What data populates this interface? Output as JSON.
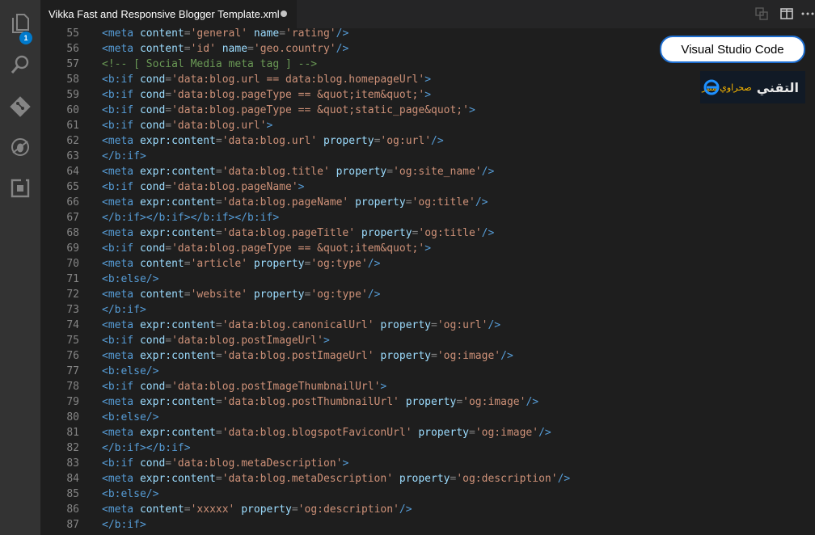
{
  "activity_bar": {
    "items": [
      {
        "name": "explorer-icon",
        "badge": "1"
      },
      {
        "name": "search-icon"
      },
      {
        "name": "source-control-icon"
      },
      {
        "name": "debug-icon"
      },
      {
        "name": "extensions-icon"
      }
    ]
  },
  "tab": {
    "title": "Vikka Fast and Responsive Blogger Template.xml",
    "dirty": true
  },
  "toolbar": {
    "actions": [
      "open-changes-icon",
      "split-editor-icon",
      "more-actions-icon"
    ]
  },
  "overlay": {
    "callout_text": "Visual Studio Code",
    "brand_main": "التقني",
    "brand_sub": "صحراوي منير",
    "brand_icon": "e"
  },
  "colors": {
    "tag": "#569cd6",
    "attr": "#9cdcfe",
    "string": "#ce9178",
    "comment": "#6a9955",
    "text": "#d4d4d4",
    "line_number": "#858585",
    "accent": "#007acc"
  },
  "editor": {
    "lines": [
      {
        "n": "55",
        "tokens": [
          [
            "tag",
            "<meta "
          ],
          [
            "attr",
            "content"
          ],
          [
            "pun",
            "="
          ],
          [
            "str",
            "'general'"
          ],
          [
            "txt",
            " "
          ],
          [
            "attr",
            "name"
          ],
          [
            "pun",
            "="
          ],
          [
            "str",
            "'rating'"
          ],
          [
            "tag",
            "/>"
          ]
        ]
      },
      {
        "n": "56",
        "tokens": [
          [
            "tag",
            "<meta "
          ],
          [
            "attr",
            "content"
          ],
          [
            "pun",
            "="
          ],
          [
            "str",
            "'id'"
          ],
          [
            "txt",
            " "
          ],
          [
            "attr",
            "name"
          ],
          [
            "pun",
            "="
          ],
          [
            "str",
            "'geo.country'"
          ],
          [
            "tag",
            "/>"
          ]
        ]
      },
      {
        "n": "57",
        "tokens": [
          [
            "cmt",
            "<!-- [ Social Media meta tag ] -->"
          ]
        ]
      },
      {
        "n": "58",
        "tokens": [
          [
            "tag",
            "<b:if "
          ],
          [
            "attr",
            "cond"
          ],
          [
            "pun",
            "="
          ],
          [
            "str",
            "'data:blog.url == data:blog.homepageUrl'"
          ],
          [
            "tag",
            ">"
          ]
        ]
      },
      {
        "n": "59",
        "tokens": [
          [
            "tag",
            "<b:if "
          ],
          [
            "attr",
            "cond"
          ],
          [
            "pun",
            "="
          ],
          [
            "str",
            "'data:blog.pageType == &quot;item&quot;'"
          ],
          [
            "tag",
            ">"
          ]
        ]
      },
      {
        "n": "60",
        "tokens": [
          [
            "tag",
            "<b:if "
          ],
          [
            "attr",
            "cond"
          ],
          [
            "pun",
            "="
          ],
          [
            "str",
            "'data:blog.pageType == &quot;static_page&quot;'"
          ],
          [
            "tag",
            ">"
          ]
        ]
      },
      {
        "n": "61",
        "tokens": [
          [
            "tag",
            "<b:if "
          ],
          [
            "attr",
            "cond"
          ],
          [
            "pun",
            "="
          ],
          [
            "str",
            "'data:blog.url'"
          ],
          [
            "tag",
            ">"
          ]
        ]
      },
      {
        "n": "62",
        "tokens": [
          [
            "tag",
            "<meta "
          ],
          [
            "attr",
            "expr:content"
          ],
          [
            "pun",
            "="
          ],
          [
            "str",
            "'data:blog.url'"
          ],
          [
            "txt",
            " "
          ],
          [
            "attr",
            "property"
          ],
          [
            "pun",
            "="
          ],
          [
            "str",
            "'og:url'"
          ],
          [
            "tag",
            "/>"
          ]
        ]
      },
      {
        "n": "63",
        "tokens": [
          [
            "tag",
            "</b:if>"
          ]
        ]
      },
      {
        "n": "64",
        "tokens": [
          [
            "tag",
            "<meta "
          ],
          [
            "attr",
            "expr:content"
          ],
          [
            "pun",
            "="
          ],
          [
            "str",
            "'data:blog.title'"
          ],
          [
            "txt",
            " "
          ],
          [
            "attr",
            "property"
          ],
          [
            "pun",
            "="
          ],
          [
            "str",
            "'og:site_name'"
          ],
          [
            "tag",
            "/>"
          ]
        ]
      },
      {
        "n": "65",
        "tokens": [
          [
            "tag",
            "<b:if "
          ],
          [
            "attr",
            "cond"
          ],
          [
            "pun",
            "="
          ],
          [
            "str",
            "'data:blog.pageName'"
          ],
          [
            "tag",
            ">"
          ]
        ]
      },
      {
        "n": "66",
        "tokens": [
          [
            "tag",
            "<meta "
          ],
          [
            "attr",
            "expr:content"
          ],
          [
            "pun",
            "="
          ],
          [
            "str",
            "'data:blog.pageName'"
          ],
          [
            "txt",
            " "
          ],
          [
            "attr",
            "property"
          ],
          [
            "pun",
            "="
          ],
          [
            "str",
            "'og:title'"
          ],
          [
            "tag",
            "/>"
          ]
        ]
      },
      {
        "n": "67",
        "tokens": [
          [
            "tag",
            "</b:if></b:if></b:if></b:if>"
          ]
        ]
      },
      {
        "n": "68",
        "tokens": [
          [
            "tag",
            "<meta "
          ],
          [
            "attr",
            "expr:content"
          ],
          [
            "pun",
            "="
          ],
          [
            "str",
            "'data:blog.pageTitle'"
          ],
          [
            "txt",
            " "
          ],
          [
            "attr",
            "property"
          ],
          [
            "pun",
            "="
          ],
          [
            "str",
            "'og:title'"
          ],
          [
            "tag",
            "/>"
          ]
        ]
      },
      {
        "n": "69",
        "tokens": [
          [
            "tag",
            "<b:if "
          ],
          [
            "attr",
            "cond"
          ],
          [
            "pun",
            "="
          ],
          [
            "str",
            "'data:blog.pageType == &quot;item&quot;'"
          ],
          [
            "tag",
            ">"
          ]
        ]
      },
      {
        "n": "70",
        "tokens": [
          [
            "tag",
            "<meta "
          ],
          [
            "attr",
            "content"
          ],
          [
            "pun",
            "="
          ],
          [
            "str",
            "'article'"
          ],
          [
            "txt",
            " "
          ],
          [
            "attr",
            "property"
          ],
          [
            "pun",
            "="
          ],
          [
            "str",
            "'og:type'"
          ],
          [
            "tag",
            "/>"
          ]
        ]
      },
      {
        "n": "71",
        "tokens": [
          [
            "tag",
            "<b:else/>"
          ]
        ]
      },
      {
        "n": "72",
        "tokens": [
          [
            "tag",
            "<meta "
          ],
          [
            "attr",
            "content"
          ],
          [
            "pun",
            "="
          ],
          [
            "str",
            "'website'"
          ],
          [
            "txt",
            " "
          ],
          [
            "attr",
            "property"
          ],
          [
            "pun",
            "="
          ],
          [
            "str",
            "'og:type'"
          ],
          [
            "tag",
            "/>"
          ]
        ]
      },
      {
        "n": "73",
        "tokens": [
          [
            "tag",
            "</b:if>"
          ]
        ]
      },
      {
        "n": "74",
        "tokens": [
          [
            "tag",
            "<meta "
          ],
          [
            "attr",
            "expr:content"
          ],
          [
            "pun",
            "="
          ],
          [
            "str",
            "'data:blog.canonicalUrl'"
          ],
          [
            "txt",
            " "
          ],
          [
            "attr",
            "property"
          ],
          [
            "pun",
            "="
          ],
          [
            "str",
            "'og:url'"
          ],
          [
            "tag",
            "/>"
          ]
        ]
      },
      {
        "n": "75",
        "tokens": [
          [
            "tag",
            "<b:if "
          ],
          [
            "attr",
            "cond"
          ],
          [
            "pun",
            "="
          ],
          [
            "str",
            "'data:blog.postImageUrl'"
          ],
          [
            "tag",
            ">"
          ]
        ]
      },
      {
        "n": "76",
        "tokens": [
          [
            "tag",
            "<meta "
          ],
          [
            "attr",
            "expr:content"
          ],
          [
            "pun",
            "="
          ],
          [
            "str",
            "'data:blog.postImageUrl'"
          ],
          [
            "txt",
            " "
          ],
          [
            "attr",
            "property"
          ],
          [
            "pun",
            "="
          ],
          [
            "str",
            "'og:image'"
          ],
          [
            "tag",
            "/>"
          ]
        ]
      },
      {
        "n": "77",
        "tokens": [
          [
            "tag",
            "<b:else/>"
          ]
        ]
      },
      {
        "n": "78",
        "tokens": [
          [
            "tag",
            "<b:if "
          ],
          [
            "attr",
            "cond"
          ],
          [
            "pun",
            "="
          ],
          [
            "str",
            "'data:blog.postImageThumbnailUrl'"
          ],
          [
            "tag",
            ">"
          ]
        ]
      },
      {
        "n": "79",
        "tokens": [
          [
            "tag",
            "<meta "
          ],
          [
            "attr",
            "expr:content"
          ],
          [
            "pun",
            "="
          ],
          [
            "str",
            "'data:blog.postThumbnailUrl'"
          ],
          [
            "txt",
            " "
          ],
          [
            "attr",
            "property"
          ],
          [
            "pun",
            "="
          ],
          [
            "str",
            "'og:image'"
          ],
          [
            "tag",
            "/>"
          ]
        ]
      },
      {
        "n": "80",
        "tokens": [
          [
            "tag",
            "<b:else/>"
          ]
        ]
      },
      {
        "n": "81",
        "tokens": [
          [
            "tag",
            "<meta "
          ],
          [
            "attr",
            "expr:content"
          ],
          [
            "pun",
            "="
          ],
          [
            "str",
            "'data:blog.blogspotFaviconUrl'"
          ],
          [
            "txt",
            " "
          ],
          [
            "attr",
            "property"
          ],
          [
            "pun",
            "="
          ],
          [
            "str",
            "'og:image'"
          ],
          [
            "tag",
            "/>"
          ]
        ]
      },
      {
        "n": "82",
        "tokens": [
          [
            "tag",
            "</b:if></b:if>"
          ]
        ]
      },
      {
        "n": "83",
        "tokens": [
          [
            "tag",
            "<b:if "
          ],
          [
            "attr",
            "cond"
          ],
          [
            "pun",
            "="
          ],
          [
            "str",
            "'data:blog.metaDescription'"
          ],
          [
            "tag",
            ">"
          ]
        ]
      },
      {
        "n": "84",
        "tokens": [
          [
            "tag",
            "<meta "
          ],
          [
            "attr",
            "expr:content"
          ],
          [
            "pun",
            "="
          ],
          [
            "str",
            "'data:blog.metaDescription'"
          ],
          [
            "txt",
            " "
          ],
          [
            "attr",
            "property"
          ],
          [
            "pun",
            "="
          ],
          [
            "str",
            "'og:description'"
          ],
          [
            "tag",
            "/>"
          ]
        ]
      },
      {
        "n": "85",
        "tokens": [
          [
            "tag",
            "<b:else/>"
          ]
        ]
      },
      {
        "n": "86",
        "tokens": [
          [
            "tag",
            "<meta "
          ],
          [
            "attr",
            "content"
          ],
          [
            "pun",
            "="
          ],
          [
            "str",
            "'xxxxx'"
          ],
          [
            "txt",
            " "
          ],
          [
            "attr",
            "property"
          ],
          [
            "pun",
            "="
          ],
          [
            "str",
            "'og:description'"
          ],
          [
            "tag",
            "/>"
          ]
        ]
      },
      {
        "n": "87",
        "tokens": [
          [
            "tag",
            "</b:if>"
          ]
        ]
      }
    ]
  }
}
